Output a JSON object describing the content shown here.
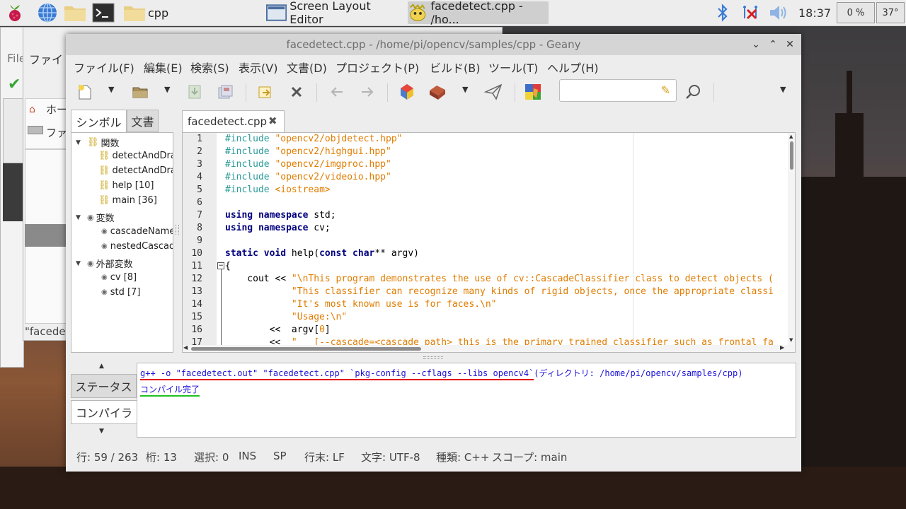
{
  "taskbar": {
    "folder_label": "cpp",
    "task_screen_layout": "Screen Layout Editor",
    "task_geany": "facedetect.cpp - /ho...",
    "clock": "18:37",
    "cpu": "0 %",
    "temp": "37°"
  },
  "background_window": {
    "file_label": "File",
    "menu_label": "ファイ",
    "home_item": "ホー",
    "file_item": "ファ",
    "status_text": "\"facede"
  },
  "window": {
    "title": "facedetect.cpp - /home/pi/opencv/samples/cpp - Geany"
  },
  "menubar": [
    "ファイル(F)",
    "編集(E)",
    "検索(S)",
    "表示(V)",
    "文書(D)",
    "プロジェクト(P)",
    "ビルド(B)",
    "ツール(T)",
    "ヘルプ(H)"
  ],
  "sidebar": {
    "tab_symbols": "シンボル",
    "tab_documents": "文書",
    "tree": {
      "functions": "関数",
      "fn1": "detectAndDraw",
      "fn2": "detectAndDraw",
      "fn3": "help [10]",
      "fn4": "main [36]",
      "variables": "変数",
      "var1": "cascadeName",
      "var2": "nestedCascade",
      "externals": "外部変数",
      "ext1": "cv [8]",
      "ext2": "std [7]"
    }
  },
  "editor": {
    "tab_label": "facedetect.cpp",
    "line_numbers": [
      "1",
      "2",
      "3",
      "4",
      "5",
      "6",
      "7",
      "8",
      "9",
      "10",
      "11",
      "12",
      "13",
      "14",
      "15",
      "16",
      "17"
    ]
  },
  "code": {
    "l1a": "#include ",
    "l1b": "\"opencv2/objdetect.hpp\"",
    "l2a": "#include ",
    "l2b": "\"opencv2/highgui.hpp\"",
    "l3a": "#include ",
    "l3b": "\"opencv2/imgproc.hpp\"",
    "l4a": "#include ",
    "l4b": "\"opencv2/videoio.hpp\"",
    "l5a": "#include ",
    "l5b": "<iostream>",
    "l7a": "using",
    "l7b": "namespace",
    "l7c": " std;",
    "l8a": "using",
    "l8b": "namespace",
    "l8c": " cv;",
    "l10a": "static",
    "l10b": "void",
    "l10c": " help(",
    "l10d": "const",
    "l10e": "char",
    "l10f": "** argv)",
    "l11": "{",
    "l12a": "    cout << ",
    "l12b": "\"\\nThis program demonstrates the use of cv::CascadeClassifier class to detect objects (",
    "l13a": "            ",
    "l13b": "\"This classifier can recognize many kinds of rigid objects, once the appropriate classi",
    "l14a": "            ",
    "l14b": "\"It's most known use is for faces.\\n\"",
    "l15a": "            ",
    "l15b": "\"Usage:\\n\"",
    "l16a": "        <<  argv[",
    "l16b": "0",
    "l16c": "]",
    "l17a": "        <<  ",
    "l17b": "\"   [--cascade=<cascade path> this is the primary trained classifier such as frontal fa"
  },
  "bottom_panel": {
    "tab_status": "ステータス",
    "tab_compiler": "コンパイラ",
    "msg_command": "g++ -o \"facedetect.out\" \"facedetect.cpp\" `pkg-config --cflags --libs opencv4`",
    "msg_dir": "(ディレクトリ: /home/pi/opencv/samples/cpp)",
    "msg_done": "コンパイル完了"
  },
  "statusbar": {
    "line": "行: 59 / 263",
    "col": "桁: 13",
    "sel": "選択: 0",
    "ins": "INS",
    "sp": "SP",
    "eol": "行末: LF",
    "enc": "文字: UTF-8",
    "type": "種類: C++",
    "scope": "スコープ: main"
  },
  "colors": {
    "string": "#e07c00",
    "preprocessor": "#2c9a9a",
    "keyword": "#00007f",
    "compiler_message": "#1a0fd9",
    "underline_red": "#e00000",
    "underline_green": "#22c022"
  }
}
